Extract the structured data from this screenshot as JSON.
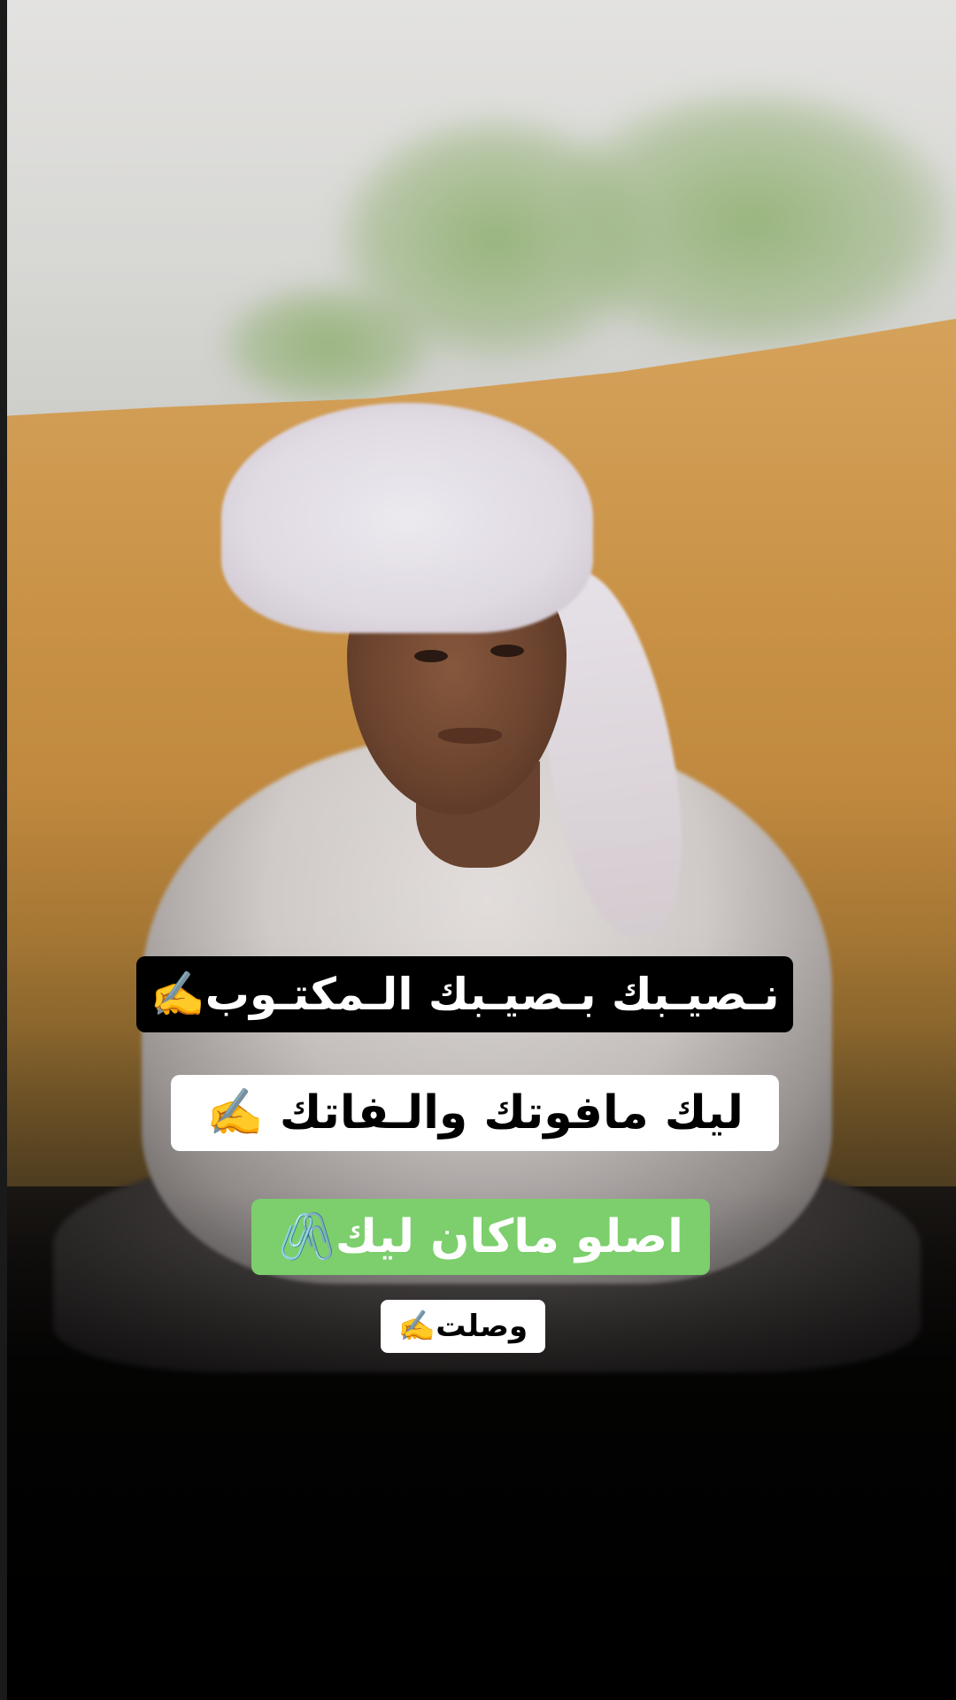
{
  "captions": {
    "line1": "نـصيـبك بـصيـبك الـمكتـوب✍️",
    "line2": "ليك مافوتك والـفاتك ✍️",
    "line3": "اصلو ماكان ليك🖇️",
    "line4": "وصلت✍️"
  },
  "colors": {
    "caption1_bg": "#000000",
    "caption2_bg": "#ffffff",
    "caption3_bg": "#7ccf6c",
    "caption4_bg": "#ffffff"
  }
}
